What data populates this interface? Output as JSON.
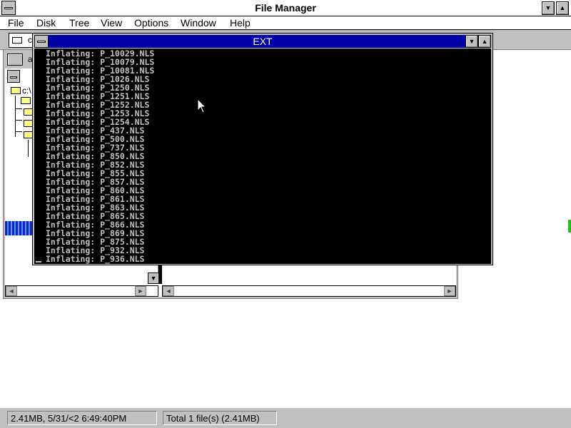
{
  "window": {
    "title": "File Manager",
    "minimize_glyph": "▼",
    "maximize_glyph": "▲"
  },
  "menu": {
    "items": [
      {
        "label": "File"
      },
      {
        "label": "Disk"
      },
      {
        "label": "Tree"
      },
      {
        "label": "View"
      },
      {
        "label": "Options"
      },
      {
        "label": "Window"
      },
      {
        "label": "Help"
      }
    ]
  },
  "drivebar": {
    "drive_label": "c"
  },
  "child": {
    "drive_label": "a",
    "tree_path": "c:\\",
    "scroll_left": "◄",
    "scroll_right": "►",
    "scroll_down": "▼"
  },
  "ext": {
    "title": "EXT",
    "minimize_glyph": "▼",
    "maximize_glyph": "▲",
    "lines": [
      "Inflating: P_10029.NLS",
      "Inflating: P_10079.NLS",
      "Inflating: P_10081.NLS",
      "Inflating: P_1026.NLS",
      "Inflating: P_1250.NLS",
      "Inflating: P_1251.NLS",
      "Inflating: P_1252.NLS",
      "Inflating: P_1253.NLS",
      "Inflating: P_1254.NLS",
      "Inflating: P_437.NLS",
      "Inflating: P_500.NLS",
      "Inflating: P_737.NLS",
      "Inflating: P_850.NLS",
      "Inflating: P_852.NLS",
      "Inflating: P_855.NLS",
      "Inflating: P_857.NLS",
      "Inflating: P_860.NLS",
      "Inflating: P_861.NLS",
      "Inflating: P_863.NLS",
      "Inflating: P_865.NLS",
      "Inflating: P_866.NLS",
      "Inflating: P_869.NLS",
      "Inflating: P_875.NLS",
      "Inflating: P_932.NLS",
      "Inflating: P_936.NLS"
    ]
  },
  "statusbar": {
    "left": "2.41MB, 5/31/<2 6:49:40PM",
    "right": "Total 1 file(s) (2.41MB)"
  },
  "colors": {
    "title_active": "#0000a8",
    "console_bg": "#000000",
    "console_text": "#c0c0c0",
    "chrome": "#c0c0c0"
  }
}
